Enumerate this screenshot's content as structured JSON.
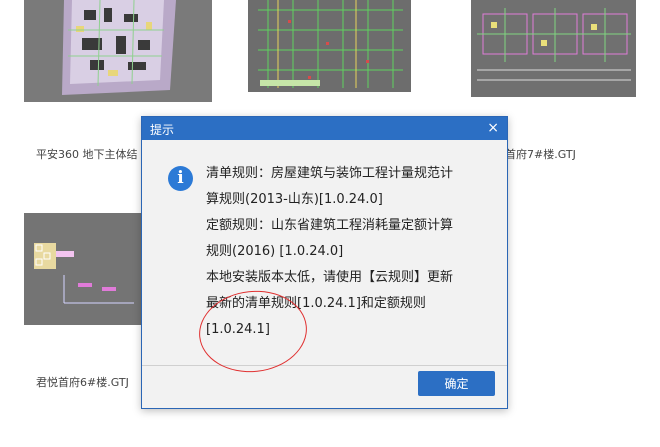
{
  "files": [
    {
      "label": "平安360 地下主体结",
      "kind": "site-plan"
    },
    {
      "label": "",
      "kind": "floor-plan-green"
    },
    {
      "label": "首府7#楼.GTJ",
      "kind": "building-plan"
    },
    {
      "label": "君悦首府6#楼.GTJ",
      "kind": "sparse-plan"
    }
  ],
  "dialog": {
    "title": "提示",
    "close_glyph": "×",
    "icon_glyph": "i",
    "message_lines": [
      "清单规则：房屋建筑与装饰工程计量规范计",
      "算规则(2013-山东)[1.0.24.0]",
      "定额规则：山东省建筑工程消耗量定额计算",
      "规则(2016) [1.0.24.0]",
      "本地安装版本太低，请使用【云规则】更新",
      "最新的清单规则[1.0.24.1]和定额规则",
      "[1.0.24.1]"
    ],
    "ok_label": "确定"
  },
  "colors": {
    "titlebar": "#2c6fc4",
    "button": "#2c6fc4",
    "info_icon": "#2c7ad6",
    "annotation": "#e03030",
    "thumb_bg": "#6e6e6e"
  }
}
